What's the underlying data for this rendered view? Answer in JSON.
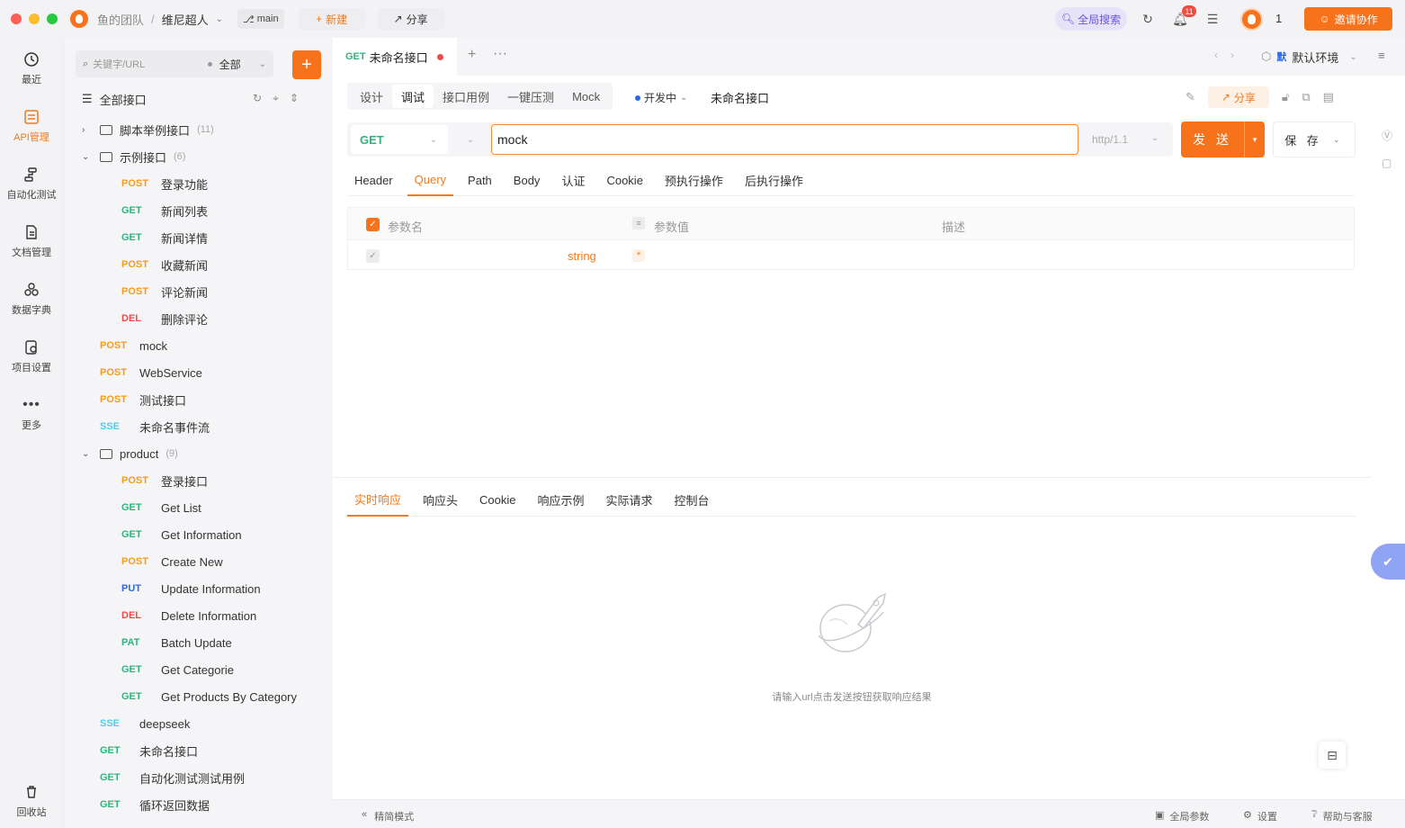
{
  "titlebar": {
    "team": "鱼的团队",
    "project": "维尼超人",
    "branch": "main",
    "new_label": "新建",
    "share_label": "分享",
    "global_search": "全局搜索",
    "notification_count": "11",
    "user_count": "1",
    "invite_label": "邀请协作"
  },
  "rail": [
    {
      "name": "recent",
      "label": "最近",
      "icon": "clock-icon",
      "active": false
    },
    {
      "name": "api",
      "label": "API管理",
      "icon": "api-icon",
      "active": true
    },
    {
      "name": "autotest",
      "label": "自动化测试",
      "icon": "flow-icon",
      "active": false
    },
    {
      "name": "docs",
      "label": "文档管理",
      "icon": "doc-icon",
      "active": false
    },
    {
      "name": "dict",
      "label": "数据字典",
      "icon": "dict-icon",
      "active": false
    },
    {
      "name": "settings",
      "label": "项目设置",
      "icon": "project-settings-icon",
      "active": false
    },
    {
      "name": "more",
      "label": "更多",
      "icon": "more-icon",
      "active": false
    }
  ],
  "rail_trash": "回收站",
  "sidebar": {
    "search_placeholder": "关键字/URL",
    "filter_label": "全部",
    "all_apis": "全部接口",
    "tree": [
      {
        "type": "folder",
        "label": "脚本举例接口",
        "count": "(11)",
        "expanded": false,
        "indent": 0
      },
      {
        "type": "folder",
        "label": "示例接口",
        "count": "(6)",
        "expanded": true,
        "indent": 0
      },
      {
        "type": "api",
        "method": "POST",
        "label": "登录功能",
        "indent": 1
      },
      {
        "type": "api",
        "method": "GET",
        "label": "新闻列表",
        "indent": 1
      },
      {
        "type": "api",
        "method": "GET",
        "label": "新闻详情",
        "indent": 1
      },
      {
        "type": "api",
        "method": "POST",
        "label": "收藏新闻",
        "indent": 1
      },
      {
        "type": "api",
        "method": "POST",
        "label": "评论新闻",
        "indent": 1
      },
      {
        "type": "api",
        "method": "DEL",
        "label": "删除评论",
        "indent": 1
      },
      {
        "type": "api",
        "method": "POST",
        "label": "mock",
        "indent": 0
      },
      {
        "type": "api",
        "method": "POST",
        "label": "WebService",
        "indent": 0
      },
      {
        "type": "api",
        "method": "POST",
        "label": "测试接口",
        "indent": 0
      },
      {
        "type": "api",
        "method": "SSE",
        "label": "未命名事件流",
        "indent": 0
      },
      {
        "type": "folder",
        "label": "product",
        "count": "(9)",
        "expanded": true,
        "indent": 0
      },
      {
        "type": "api",
        "method": "POST",
        "label": "登录接口",
        "indent": 1
      },
      {
        "type": "api",
        "method": "GET",
        "label": "Get List",
        "indent": 1
      },
      {
        "type": "api",
        "method": "GET",
        "label": "Get Information",
        "indent": 1
      },
      {
        "type": "api",
        "method": "POST",
        "label": "Create New",
        "indent": 1
      },
      {
        "type": "api",
        "method": "PUT",
        "label": "Update Information",
        "indent": 1
      },
      {
        "type": "api",
        "method": "DEL",
        "label": "Delete Information",
        "indent": 1
      },
      {
        "type": "api",
        "method": "PAT",
        "label": "Batch Update",
        "indent": 1
      },
      {
        "type": "api",
        "method": "GET",
        "label": "Get Categorie",
        "indent": 1
      },
      {
        "type": "api",
        "method": "GET",
        "label": "Get Products By Category",
        "indent": 1
      },
      {
        "type": "api",
        "method": "SSE",
        "label": "deepseek",
        "indent": 0
      },
      {
        "type": "api",
        "method": "GET",
        "label": "未命名接口",
        "indent": 0
      },
      {
        "type": "api",
        "method": "GET",
        "label": "自动化测试测试用例",
        "indent": 0
      },
      {
        "type": "api",
        "method": "GET",
        "label": "循环返回数据",
        "indent": 0
      }
    ]
  },
  "tab": {
    "method": "GET",
    "title": "未命名接口"
  },
  "env": {
    "badge": "默",
    "label": "默认环境"
  },
  "subtabs": [
    "设计",
    "调试",
    "接口用例",
    "一键压测",
    "Mock"
  ],
  "active_subtab": 1,
  "status": "开发中",
  "api_name": "未命名接口",
  "share_label": "分享",
  "request": {
    "method": "GET",
    "url": "mock",
    "protocol": "http/1.1",
    "send_label": "发 送",
    "save_label": "保 存"
  },
  "param_tabs": [
    "Header",
    "Query",
    "Path",
    "Body",
    "认证",
    "Cookie",
    "预执行操作",
    "后执行操作"
  ],
  "active_param_tab": 1,
  "param_table": {
    "headers": {
      "name": "参数名",
      "value": "参数值",
      "desc": "描述"
    },
    "row": {
      "type": "string",
      "required": "*"
    }
  },
  "response_tabs": [
    "实时响应",
    "响应头",
    "Cookie",
    "响应示例",
    "实际请求",
    "控制台"
  ],
  "active_response_tab": 0,
  "empty_hint": "请输入url点击发送按钮获取响应结果",
  "footer": {
    "simple_mode": "精简模式",
    "global_params": "全局参数",
    "settings": "设置",
    "help": "帮助与客服"
  },
  "colors": {
    "accent": "#f7731b",
    "get": "#2fb47c",
    "post": "#f59c18",
    "delete": "#ee4c4c",
    "put": "#2d67e6",
    "sse": "#5ac8e8"
  }
}
